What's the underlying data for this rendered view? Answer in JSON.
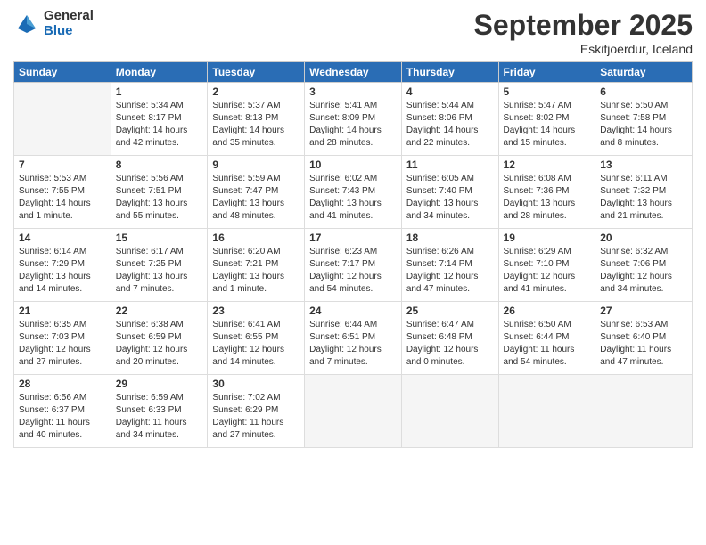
{
  "logo": {
    "general": "General",
    "blue": "Blue"
  },
  "header": {
    "month": "September 2025",
    "location": "Eskifjoerdur, Iceland"
  },
  "weekdays": [
    "Sunday",
    "Monday",
    "Tuesday",
    "Wednesday",
    "Thursday",
    "Friday",
    "Saturday"
  ],
  "weeks": [
    [
      {
        "day": "",
        "info": ""
      },
      {
        "day": "1",
        "info": "Sunrise: 5:34 AM\nSunset: 8:17 PM\nDaylight: 14 hours\nand 42 minutes."
      },
      {
        "day": "2",
        "info": "Sunrise: 5:37 AM\nSunset: 8:13 PM\nDaylight: 14 hours\nand 35 minutes."
      },
      {
        "day": "3",
        "info": "Sunrise: 5:41 AM\nSunset: 8:09 PM\nDaylight: 14 hours\nand 28 minutes."
      },
      {
        "day": "4",
        "info": "Sunrise: 5:44 AM\nSunset: 8:06 PM\nDaylight: 14 hours\nand 22 minutes."
      },
      {
        "day": "5",
        "info": "Sunrise: 5:47 AM\nSunset: 8:02 PM\nDaylight: 14 hours\nand 15 minutes."
      },
      {
        "day": "6",
        "info": "Sunrise: 5:50 AM\nSunset: 7:58 PM\nDaylight: 14 hours\nand 8 minutes."
      }
    ],
    [
      {
        "day": "7",
        "info": "Sunrise: 5:53 AM\nSunset: 7:55 PM\nDaylight: 14 hours\nand 1 minute."
      },
      {
        "day": "8",
        "info": "Sunrise: 5:56 AM\nSunset: 7:51 PM\nDaylight: 13 hours\nand 55 minutes."
      },
      {
        "day": "9",
        "info": "Sunrise: 5:59 AM\nSunset: 7:47 PM\nDaylight: 13 hours\nand 48 minutes."
      },
      {
        "day": "10",
        "info": "Sunrise: 6:02 AM\nSunset: 7:43 PM\nDaylight: 13 hours\nand 41 minutes."
      },
      {
        "day": "11",
        "info": "Sunrise: 6:05 AM\nSunset: 7:40 PM\nDaylight: 13 hours\nand 34 minutes."
      },
      {
        "day": "12",
        "info": "Sunrise: 6:08 AM\nSunset: 7:36 PM\nDaylight: 13 hours\nand 28 minutes."
      },
      {
        "day": "13",
        "info": "Sunrise: 6:11 AM\nSunset: 7:32 PM\nDaylight: 13 hours\nand 21 minutes."
      }
    ],
    [
      {
        "day": "14",
        "info": "Sunrise: 6:14 AM\nSunset: 7:29 PM\nDaylight: 13 hours\nand 14 minutes."
      },
      {
        "day": "15",
        "info": "Sunrise: 6:17 AM\nSunset: 7:25 PM\nDaylight: 13 hours\nand 7 minutes."
      },
      {
        "day": "16",
        "info": "Sunrise: 6:20 AM\nSunset: 7:21 PM\nDaylight: 13 hours\nand 1 minute."
      },
      {
        "day": "17",
        "info": "Sunrise: 6:23 AM\nSunset: 7:17 PM\nDaylight: 12 hours\nand 54 minutes."
      },
      {
        "day": "18",
        "info": "Sunrise: 6:26 AM\nSunset: 7:14 PM\nDaylight: 12 hours\nand 47 minutes."
      },
      {
        "day": "19",
        "info": "Sunrise: 6:29 AM\nSunset: 7:10 PM\nDaylight: 12 hours\nand 41 minutes."
      },
      {
        "day": "20",
        "info": "Sunrise: 6:32 AM\nSunset: 7:06 PM\nDaylight: 12 hours\nand 34 minutes."
      }
    ],
    [
      {
        "day": "21",
        "info": "Sunrise: 6:35 AM\nSunset: 7:03 PM\nDaylight: 12 hours\nand 27 minutes."
      },
      {
        "day": "22",
        "info": "Sunrise: 6:38 AM\nSunset: 6:59 PM\nDaylight: 12 hours\nand 20 minutes."
      },
      {
        "day": "23",
        "info": "Sunrise: 6:41 AM\nSunset: 6:55 PM\nDaylight: 12 hours\nand 14 minutes."
      },
      {
        "day": "24",
        "info": "Sunrise: 6:44 AM\nSunset: 6:51 PM\nDaylight: 12 hours\nand 7 minutes."
      },
      {
        "day": "25",
        "info": "Sunrise: 6:47 AM\nSunset: 6:48 PM\nDaylight: 12 hours\nand 0 minutes."
      },
      {
        "day": "26",
        "info": "Sunrise: 6:50 AM\nSunset: 6:44 PM\nDaylight: 11 hours\nand 54 minutes."
      },
      {
        "day": "27",
        "info": "Sunrise: 6:53 AM\nSunset: 6:40 PM\nDaylight: 11 hours\nand 47 minutes."
      }
    ],
    [
      {
        "day": "28",
        "info": "Sunrise: 6:56 AM\nSunset: 6:37 PM\nDaylight: 11 hours\nand 40 minutes."
      },
      {
        "day": "29",
        "info": "Sunrise: 6:59 AM\nSunset: 6:33 PM\nDaylight: 11 hours\nand 34 minutes."
      },
      {
        "day": "30",
        "info": "Sunrise: 7:02 AM\nSunset: 6:29 PM\nDaylight: 11 hours\nand 27 minutes."
      },
      {
        "day": "",
        "info": ""
      },
      {
        "day": "",
        "info": ""
      },
      {
        "day": "",
        "info": ""
      },
      {
        "day": "",
        "info": ""
      }
    ]
  ]
}
